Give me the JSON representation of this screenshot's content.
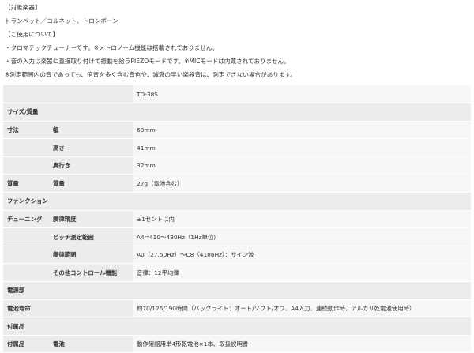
{
  "intro": {
    "line1": "【対象楽器】",
    "line2": "トランペット／コルネット、トロンボーン",
    "line3": "【ご使用について】",
    "line4": "・クロマチックチューナーです。※メトロノーム機能は搭載されておりません。",
    "line5": "・音の入力は楽器に直接取り付けて振動を拾うPIEZOモードです。※MICモードは内蔵されておりません。",
    "line6": "※測定範囲内の音であっても、倍音を多く含む音色や、減衰の早い楽器音は、測定できない場合があります。"
  },
  "table": {
    "model": "TD-38S",
    "size_section": "サイズ/質量",
    "dim_label": "寸法",
    "width_label": "幅",
    "width_value": "60mm",
    "height_label": "高さ",
    "height_value": "41mm",
    "depth_label": "奥行き",
    "depth_value": "32mm",
    "mass_label": "質量",
    "mass_sub_label": "質量",
    "mass_value": "27g（電池含む）",
    "function_section": "ファンクション",
    "tuning_label": "チューニング",
    "accuracy_label": "調律精度",
    "accuracy_value": "±1セント以内",
    "pitch_label": "ピッチ測定範囲",
    "pitch_value": "A4=410〜480Hz（1Hz単位)",
    "range_label": "調律範囲",
    "range_value": "A0（27.50Hz）〜C8（4186Hz）：サイン波",
    "other_label": "その他コントロール機能",
    "other_value": "音律：12平均律",
    "power_section": "電源部",
    "battery_life_label": "電池寿命",
    "battery_life_value": "約70/125/190時間（バックライト：オート/ソフト/オフ、A4入力、連続動作時、アルカリ乾電池使用時）",
    "accessory_section": "付属品",
    "accessory_label": "付属品",
    "accessory_sub_label": "電池",
    "accessory_value": "動作確認用単4形乾電池×1本、取扱説明書"
  }
}
